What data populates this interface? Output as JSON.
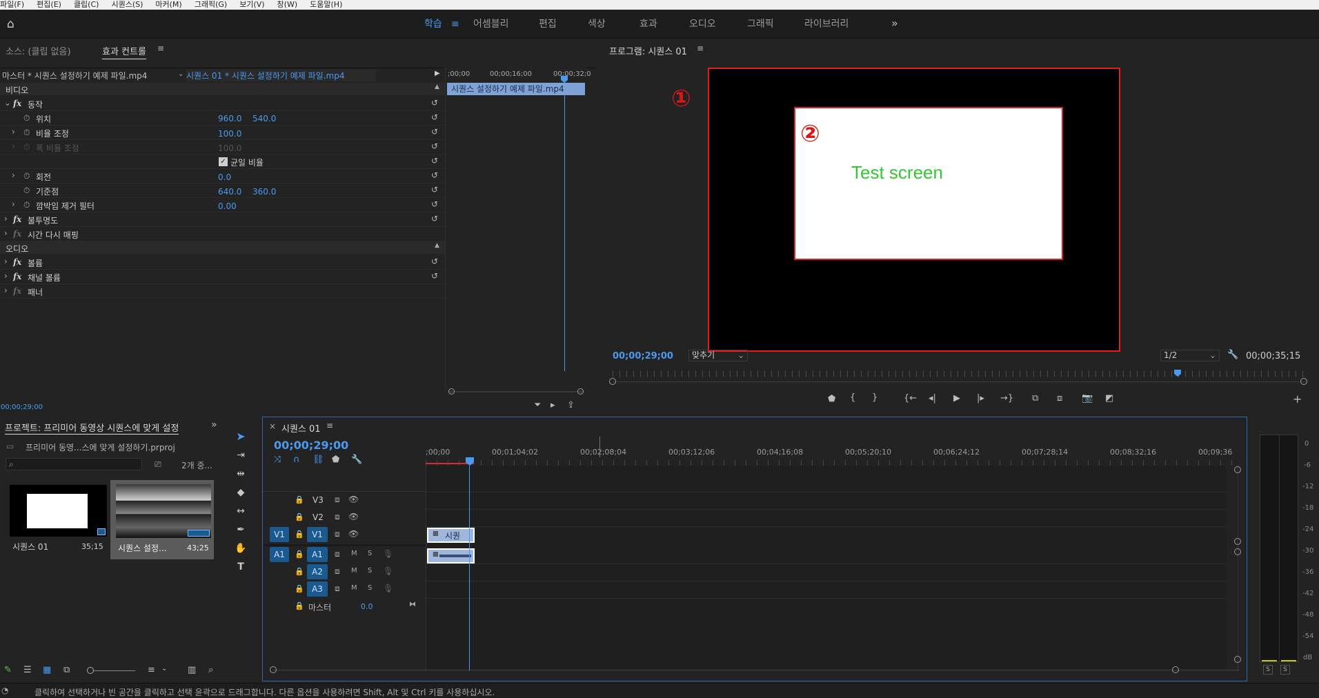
{
  "menu": [
    "파일(F)",
    "편집(E)",
    "클립(C)",
    "시퀀스(S)",
    "마커(M)",
    "그래픽(G)",
    "보기(V)",
    "창(W)",
    "도움말(H)"
  ],
  "workspaces": [
    {
      "label": "학습",
      "active": true
    },
    {
      "label": "≡",
      "active": true
    },
    {
      "label": "어셈블리"
    },
    {
      "label": "편집"
    },
    {
      "label": "색상"
    },
    {
      "label": "효과"
    },
    {
      "label": "오디오"
    },
    {
      "label": "그래픽"
    },
    {
      "label": "라이브러리"
    }
  ],
  "more_label": "»",
  "source_panel": {
    "tab_source": "소스: (클립 없음)",
    "tab_effects": "효과 컨트롤",
    "menu": "≡"
  },
  "effects": {
    "master_label": "마스터 * 시퀀스 설정하기 예제 파일.mp4",
    "sequence_label": "시퀀스 01 * 시퀀스 설정하기 예제 파일.mp4",
    "section_video": "비디오",
    "motion": "동작",
    "position": "위치",
    "position_x": "960.0",
    "position_y": "540.0",
    "scale": "비율 조정",
    "scale_value": "100.0",
    "scale_width": "폭 비율 조정",
    "scale_width_value": "100.0",
    "uniform": "균일 비율",
    "rotation": "회전",
    "rotation_value": "0.0",
    "anchor": "기준점",
    "anchor_x": "640.0",
    "anchor_y": "360.0",
    "flicker": "깜박임 제거 필터",
    "flicker_value": "0.00",
    "opacity": "불투명도",
    "time_remap": "시간 다시 매핑",
    "section_audio": "오디오",
    "volume": "볼륨",
    "channel_volume": "채널 볼륨",
    "panner": "패너",
    "timecode": "00;00;29;00",
    "mini_ticks": [
      ";00;00",
      "00;00;16;00",
      "00;00;32;0"
    ],
    "clip_label": "시퀀스 설정하기 예제 파일.mp4"
  },
  "program": {
    "title": "프로그램: 시퀀스 01",
    "menu": "≡",
    "marker1": "①",
    "marker2": "②",
    "screen_text": "Test screen",
    "timecode": "00;00;29;00",
    "fit": "맞추기",
    "resolution": "1/2",
    "duration": "00;00;35;15",
    "accent": "#4a9bf0",
    "outline": "#e02020",
    "screen_text_color": "#32c832"
  },
  "project": {
    "title": "프로젝트: 프리미어 동영상 시퀀스에 맞게 설정",
    "file": "프리미어 동영...스에 맞게 설정하기.prproj",
    "count": "2개 중...",
    "items": [
      {
        "name": "시퀀스 01",
        "duration": "35;15"
      },
      {
        "name": "시퀀스 설정...",
        "duration": "43;25"
      }
    ]
  },
  "timeline": {
    "close": "×",
    "tab": "시퀀스 01",
    "menu": "≡",
    "timecode": "00;00;29;00",
    "ticks": [
      ";00;00",
      "00;01;04;02",
      "00;02;08;04",
      "00;03;12;06",
      "00;04;16;08",
      "00;05;20;10",
      "00;06;24;12",
      "00;07;28;14",
      "00;08;32;16",
      "00;09;36"
    ],
    "tracks": {
      "v3": "V3",
      "v2": "V2",
      "v1": "V1",
      "a1": "A1",
      "a2": "A2",
      "a3": "A3",
      "master": "마스터",
      "master_value": "0.0",
      "m": "M",
      "s": "S"
    },
    "clip_label": "시퀀"
  },
  "meter": {
    "labels": [
      "0",
      "-6",
      "-12",
      "-18",
      "-24",
      "-30",
      "-36",
      "-42",
      "-48",
      "-54",
      "dB"
    ],
    "solo": "S"
  },
  "status": "클릭하여 선택하거나 빈 공간을 클릭하고 선택 윤곽으로 드래그합니다. 다른 옵션을 사용하려면 Shift, Alt 및 Ctrl 키를 사용하십시오."
}
